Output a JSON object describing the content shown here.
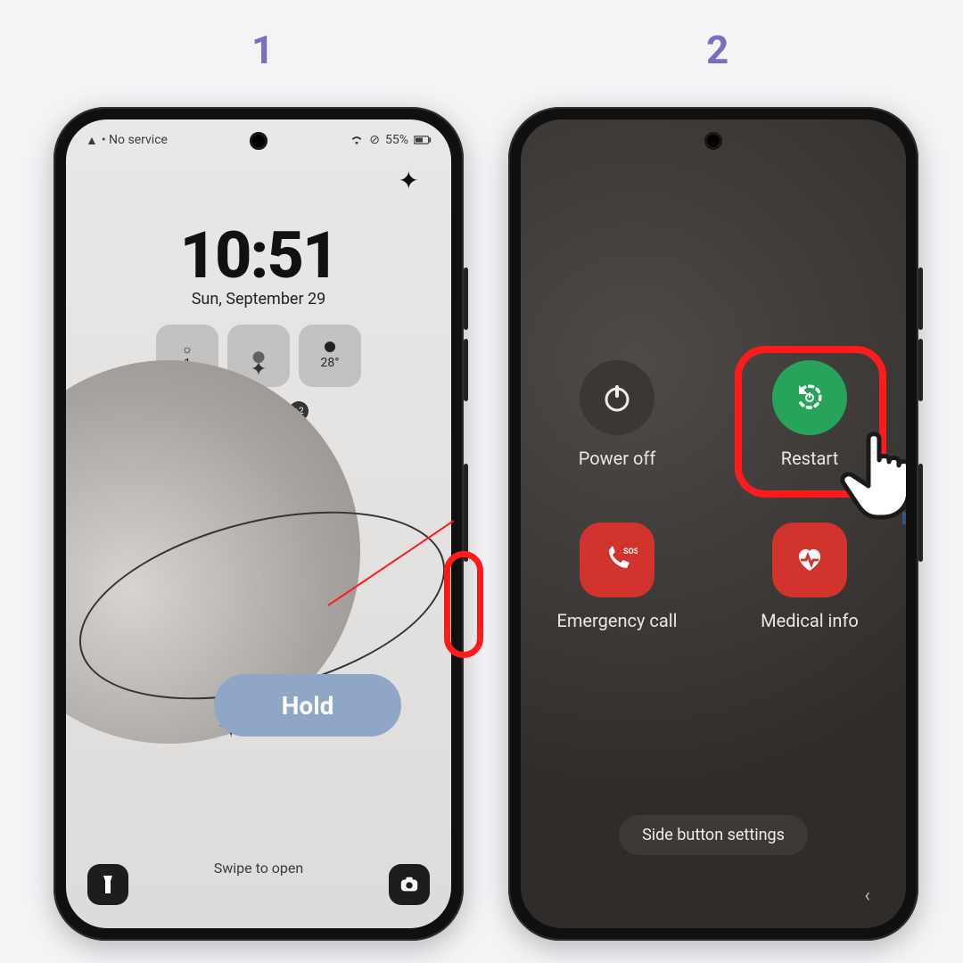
{
  "steps": {
    "one": "1",
    "two": "2"
  },
  "phone1": {
    "status": {
      "carrier": "• No service",
      "battery": "55%"
    },
    "clock": {
      "time": "10:51",
      "date": "Sun, September 29"
    },
    "widgets": {
      "w1": "1",
      "w3": "28°"
    },
    "notif_extra": "+2",
    "swipe": "Swipe to open",
    "annotation_hold": "Hold"
  },
  "phone2": {
    "power_off": "Power off",
    "restart": "Restart",
    "emergency": "Emergency call",
    "medical": "Medical info",
    "side_settings": "Side button settings",
    "sos": "SOS"
  }
}
